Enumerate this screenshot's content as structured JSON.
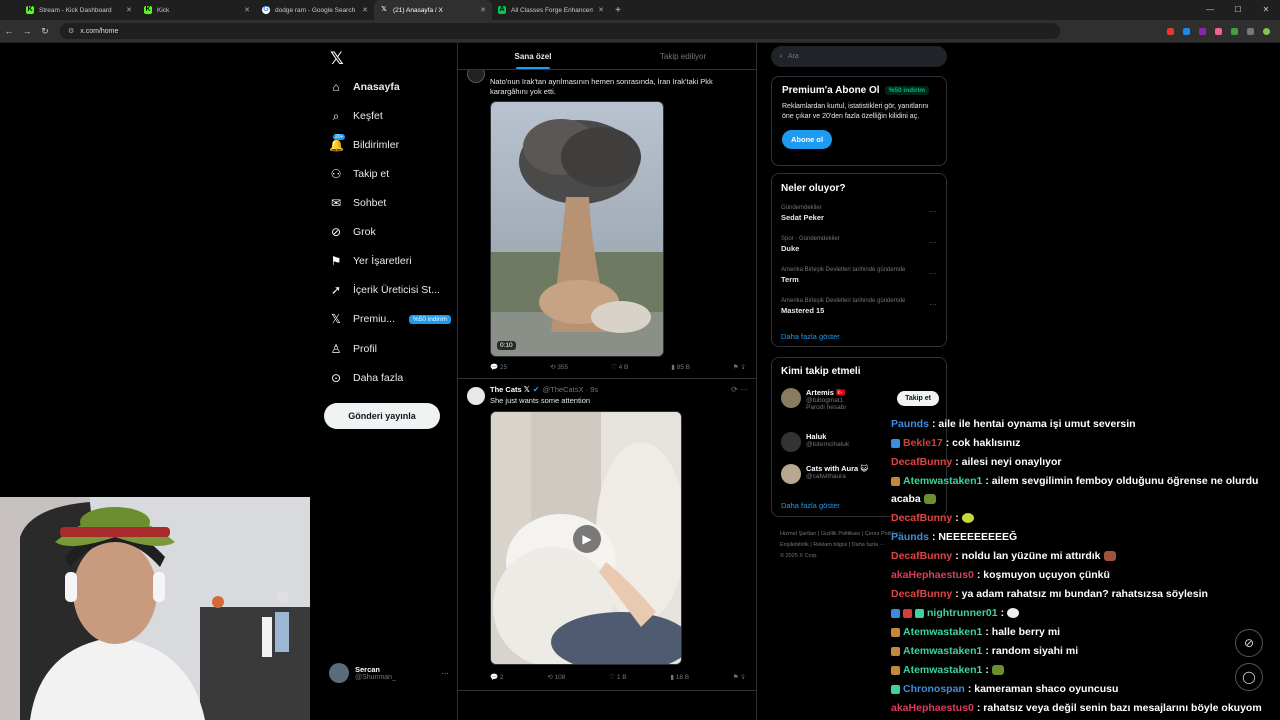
{
  "browser": {
    "tabs": [
      {
        "title": "Stream - Kick Dashboard",
        "fav_color": "#53fc18",
        "fav_glyph": "K"
      },
      {
        "title": "Kick",
        "fav_color": "#53fc18",
        "fav_glyph": "K"
      },
      {
        "title": "dodge ram - Google Search",
        "fav_color": "#ffffff",
        "fav_glyph": "G"
      },
      {
        "title": "(21) Anasayfa / X",
        "fav_color": "#ffffff",
        "fav_glyph": "X"
      },
      {
        "title": "All Classes Forge Enhanceme...",
        "fav_color": "#00c853",
        "fav_glyph": "A"
      }
    ],
    "url": "x.com/home"
  },
  "nav": {
    "items": [
      {
        "label": "Anasayfa",
        "icon": "home-icon",
        "glyph": "⌂"
      },
      {
        "label": "Keşfet",
        "icon": "search-icon",
        "glyph": "⌕"
      },
      {
        "label": "Bildirimler",
        "icon": "bell-icon",
        "glyph": "♫"
      },
      {
        "label": "Takip et",
        "icon": "add-user-icon",
        "glyph": "⚇"
      },
      {
        "label": "Sohbet",
        "icon": "mail-icon",
        "glyph": "✉"
      },
      {
        "label": "Grok",
        "icon": "grok-icon",
        "glyph": "⊘"
      },
      {
        "label": "Yer İşaretleri",
        "icon": "bookmark-icon",
        "glyph": "⚑"
      },
      {
        "label": "İçerik Üreticisi St...",
        "icon": "rocket-icon",
        "glyph": "➚"
      },
      {
        "label": "Premiu...",
        "icon": "x-icon",
        "glyph": "𝕏"
      },
      {
        "label": "Profil",
        "icon": "profile-icon",
        "glyph": "♙"
      },
      {
        "label": "Daha fazla",
        "icon": "more-circle-icon",
        "glyph": "⊙"
      }
    ],
    "notif_count": "20+",
    "premium_badge": "%50 indirim",
    "post_button": "Gönderi yayınla",
    "account": {
      "name": "Sercan",
      "handle": "@Shuriman_"
    }
  },
  "feed": {
    "tabs": [
      "Sana özel",
      "Takip ediliyor"
    ],
    "post1": {
      "text": "Nato'nun Irak'tan ayrılmasının hemen sonrasında, İran Irak'taki Pkk karargâhını yok etti.",
      "duration": "0:10",
      "replies": "25",
      "reposts": "355",
      "likes": "4 B",
      "views": "85 B"
    },
    "post2": {
      "name": "The Cats 𝕏",
      "handle": "@TheCatsX · 9s",
      "text": "She just wants some attention",
      "replies": "2",
      "reposts": "108",
      "likes": "1 B",
      "views": "18 B"
    }
  },
  "right": {
    "search_placeholder": "Ara",
    "premium": {
      "title": "Premium'a Abone Ol",
      "badge": "%50 indirim",
      "text": "Reklamlardan kurtul, istatistikleri gör, yanıtlarını öne çıkar ve 20'den fazla özelliğin kilidini aç.",
      "button": "Abone ol"
    },
    "trends": {
      "title": "Neler oluyor?",
      "items": [
        {
          "context": "Gündemdekiler",
          "name": "Sedat Peker"
        },
        {
          "context": "Spor · Gündemdekiler",
          "name": "Duke"
        },
        {
          "context": "Amerika Birleşik Devletleri tarihinde gündemde",
          "name": "Term"
        },
        {
          "context": "Amerika Birleşik Devletleri tarihinde gündemde",
          "name": "Mastered 15"
        }
      ],
      "more": "Daha fazla göster"
    },
    "who": {
      "title": "Kimi takip etmeli",
      "items": [
        {
          "name": "Artemis 🇹🇷",
          "handle": "@tubogmat1",
          "extra": "Parodi hesabı"
        },
        {
          "name": "Haluk",
          "handle": "@totemcihaluk",
          "extra": ""
        },
        {
          "name": "Cats with Aura 😺",
          "handle": "@catwithaura",
          "extra": ""
        }
      ],
      "follow": "Takip et",
      "more": "Daha fazla göster"
    },
    "footer": [
      "Hizmet Şartları",
      "Gizlilik Politikası",
      "Çerez Politikası",
      "Erişilebilirlik",
      "Reklam bilgisi",
      "Daha fazla ···",
      "© 2025 X Corp."
    ]
  },
  "chat": [
    {
      "user": "Paunds",
      "color": "#3d8ce0",
      "text": ": aile ile hentai oynama işi umut seversin"
    },
    {
      "user": "Bekle17",
      "color": "#d73c3c",
      "text": ": cok haklısınız"
    },
    {
      "user": "DecafBunny",
      "color": "#e04545",
      "text": ": ailesi neyi onaylıyor"
    },
    {
      "user": "Atemwastaken1",
      "color": "#3ed39a",
      "text": ": ailem sevgilimin femboy olduğunu öğrense ne olurdu"
    },
    {
      "user": "",
      "color": "#fff",
      "text": "acaba"
    },
    {
      "user": "DecafBunny",
      "color": "#e04545",
      "text": ":"
    },
    {
      "user": "Paunds",
      "color": "#3d8ce0",
      "text": ": NEEEEEEEEEĞ"
    },
    {
      "user": "DecafBunny",
      "color": "#e04545",
      "text": ": noldu lan yüzüne mi attırdık"
    },
    {
      "user": "akaHephaestus0",
      "color": "#e03c5a",
      "text": ": koşmuyon uçuyon çünkü"
    },
    {
      "user": "DecafBunny",
      "color": "#e04545",
      "text": ": ya adam rahatsız mı bundan? rahatsızsa söylesin"
    },
    {
      "user": "nightrunner01",
      "color": "#3ed39a",
      "text": ":"
    },
    {
      "user": "Atemwastaken1",
      "color": "#3ed39a",
      "text": ": halle berry mi"
    },
    {
      "user": "Atemwastaken1",
      "color": "#3ed39a",
      "text": ": random siyahi mi"
    },
    {
      "user": "Atemwastaken1",
      "color": "#3ed39a",
      "text": ":"
    },
    {
      "user": "Chronospan",
      "color": "#3d8ce0",
      "text": ": kameraman shaco oyuncusu"
    },
    {
      "user": "akaHephaestus0",
      "color": "#e03c5a",
      "text": ": rahatsız veya değil senin bazı mesajlarını  böyle okuyom"
    }
  ]
}
